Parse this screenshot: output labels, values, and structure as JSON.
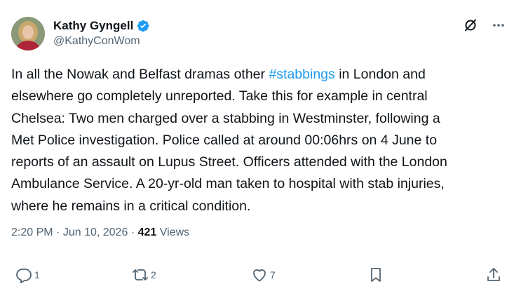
{
  "author": {
    "name": "Kathy Gyngell",
    "handle": "@KathyConWom",
    "verified": true
  },
  "tweet": {
    "lines": [
      [
        "In all the Nowak and Belfast dramas other ",
        "#stabbings",
        " in London and"
      ],
      [
        "elsewhere go completely unreported. Take this for example in central"
      ],
      [
        "Chelsea: Two men charged over a stabbing in Westminster, following a"
      ],
      [
        "Met Police investigation. Police called at around 00:06hrs on 4 June to"
      ],
      [
        "reports of an assault on Lupus Street. Officers attended with the London"
      ],
      [
        "Ambulance Service. A 20-yr-old man taken to hospital with stab injuries,"
      ],
      [
        "where he remains in a critical condition."
      ]
    ],
    "time": "2:20 PM",
    "date": "Jun 10, 2026",
    "separator": "·",
    "views_count": "421",
    "views_label": "Views"
  },
  "actions": {
    "replies": "1",
    "reposts": "2",
    "likes": "7"
  },
  "colors": {
    "accent": "#1d9bf0",
    "text": "#0f1419",
    "muted": "#536471"
  }
}
